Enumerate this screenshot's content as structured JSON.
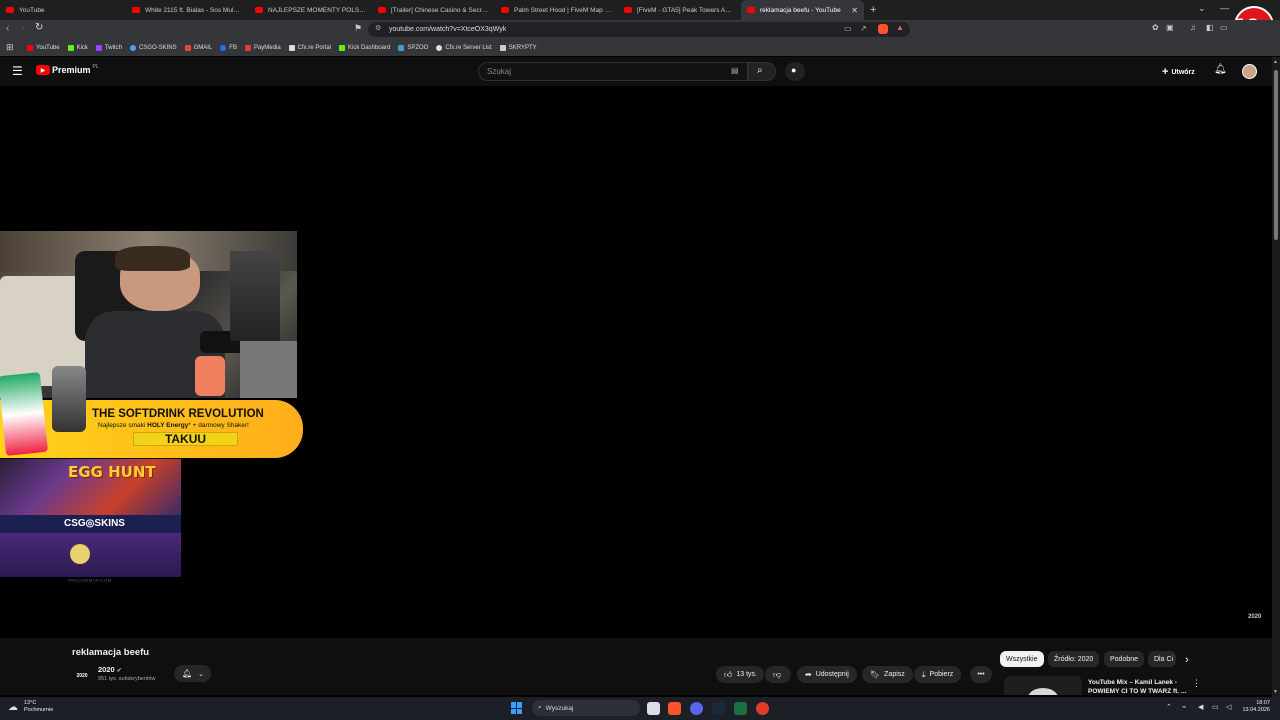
{
  "browser": {
    "tabs": [
      {
        "title": "YouTube",
        "active": false
      },
      {
        "title": "White 2115 ft. Bialas - Sos Mula [pro",
        "active": false
      },
      {
        "title": "NAJLEPSZE MOMENTY POLSKIEGO T",
        "active": false
      },
      {
        "title": "[Trailer] Chinese Casino & Secret Tria",
        "active": false
      },
      {
        "title": "Palm Street Hood | FiveM Map - You",
        "active": false
      },
      {
        "title": "[FiveM - GTA5] Peak Towers Apartme",
        "active": false
      },
      {
        "title": "reklamacja beefu - YouTube",
        "active": true
      }
    ],
    "url": "youtube.com/watch?v=XtceOX3qWyk",
    "bookmarks": [
      {
        "label": "YouTube",
        "color": "#ff0000"
      },
      {
        "label": "Kick",
        "color": "#53fc18"
      },
      {
        "label": "Twitch",
        "color": "#9146ff"
      },
      {
        "label": "CSGO-SKINS",
        "color": "#4aa3ff"
      },
      {
        "label": "GMAIL",
        "color": "#ea4335"
      },
      {
        "label": "FB",
        "color": "#1877f2"
      },
      {
        "label": "PayMedia",
        "color": "#e53935"
      },
      {
        "label": "Cfx.re Portal",
        "color": "#dddddd"
      },
      {
        "label": "Kick Dashboard",
        "color": "#53fc18"
      },
      {
        "label": "SPZOO",
        "color": "#3aa0c8"
      },
      {
        "label": "Cfx.re Server List",
        "color": "#dddddd"
      },
      {
        "label": "SKRYPTY",
        "color": "#cccccc"
      }
    ],
    "age_badge": "18+"
  },
  "youtube": {
    "logo_text": "Premium",
    "logo_region": "PL",
    "search_placeholder": "Szukaj",
    "create_label": "Utwórz",
    "video": {
      "title": "reklamacja beefu",
      "channel": "2020",
      "channel_avatar_text": "2020",
      "subscribers": "951 tys. subskrybentów",
      "watermark": "2020",
      "likes": "13 tys.",
      "share_label": "Udostępnij",
      "save_label": "Zapisz",
      "download_label": "Pobierz"
    },
    "overlay": {
      "banner_title": "THE SOFTDRINK REVOLUTION",
      "banner_sub_pre": "Najlepsze smaki ",
      "banner_sub_brand": "HOLY Energy",
      "banner_sub_post": "* + darmowy Shaker!",
      "banner_code": "TAKUU",
      "egg_hunt": "EGG HUNT",
      "csgo_logo": "CSG◎SKINS",
      "map_credit": "PRIVATEMAP.COM"
    },
    "chips": [
      {
        "label": "Wszystkie",
        "active": true
      },
      {
        "label": "Źródło: 2020",
        "active": false
      },
      {
        "label": "Podobne",
        "active": false
      },
      {
        "label": "Dla Ci",
        "active": false
      }
    ],
    "recommended": {
      "title_line1": "YouTube Mix – Kamil Lanek -",
      "title_line2": "POWIEMY CI TO W TWARZ ft. ..."
    }
  },
  "taskbar": {
    "weather_temp": "13°C",
    "weather_desc": "Pochmurnie",
    "search_label": "Wyszukaj",
    "time": "18:07",
    "date": "13.04.2026"
  }
}
